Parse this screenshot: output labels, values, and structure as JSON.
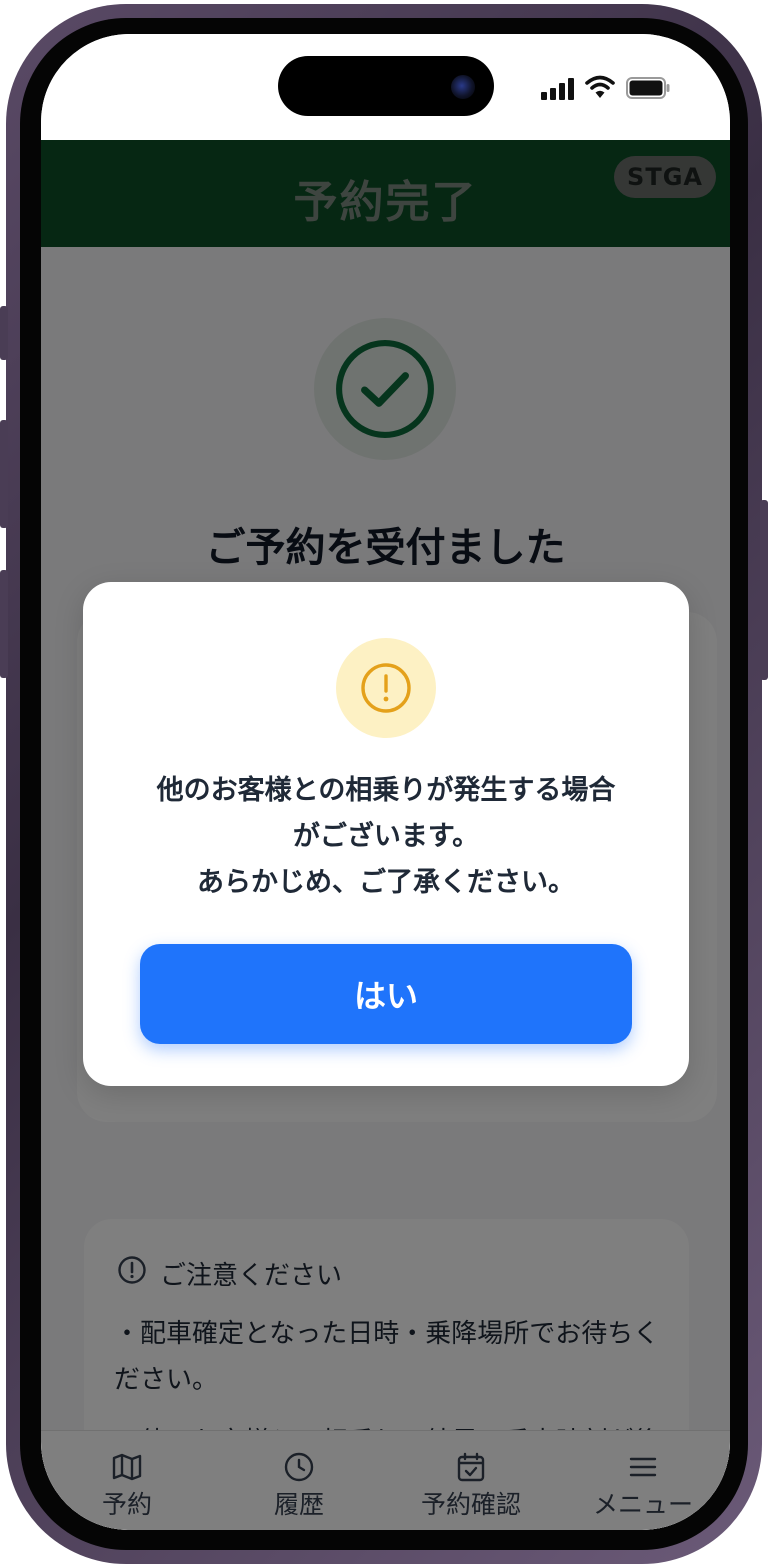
{
  "header": {
    "title": "予約完了",
    "env_badge": "STGA"
  },
  "main": {
    "success_title": "ご予約を受付ました",
    "notice": {
      "title": "ご注意ください",
      "line1": "・配車確定となった日時・乗降場所でお待ちください。",
      "line2": "・他のお客様との相乗りの結果、乗車時刻が後ろ"
    }
  },
  "dialog": {
    "message_lines": [
      "他のお客様との相乗りが発生する場合",
      "がございます。",
      "あらかじめ、ご了承ください。"
    ],
    "confirm_label": "はい"
  },
  "tabs": [
    {
      "label": "予約",
      "icon": "map-icon"
    },
    {
      "label": "履歴",
      "icon": "clock-icon"
    },
    {
      "label": "予約確認",
      "icon": "calendar-check-icon"
    },
    {
      "label": "メニュー",
      "icon": "menu-icon"
    }
  ],
  "colors": {
    "header_bg": "#0c4f26",
    "primary_button": "#1f74fb",
    "warning": "#e4a11b",
    "success": "#0c6b3a"
  }
}
